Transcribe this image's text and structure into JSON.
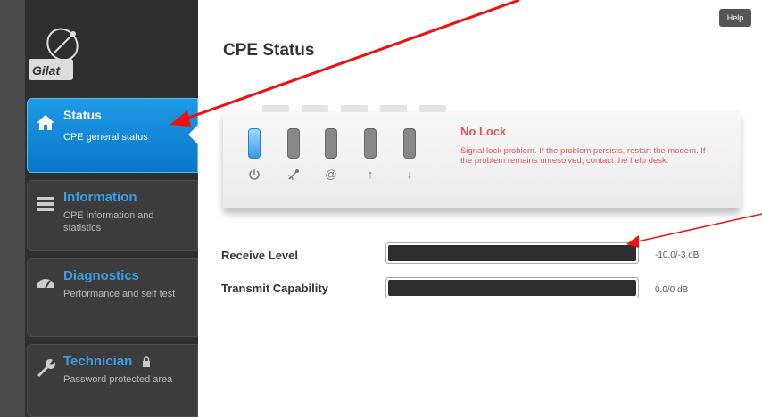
{
  "sidebar": {
    "logo_text": "Gilat",
    "items": [
      {
        "title": "Status",
        "subtitle": "CPE general status",
        "icon": "home-icon",
        "active": true
      },
      {
        "title": "Information",
        "subtitle": "CPE information and statistics",
        "icon": "list-icon",
        "active": false
      },
      {
        "title": "Diagnostics",
        "subtitle": "Performance and self test",
        "icon": "gauge-icon",
        "active": false
      },
      {
        "title": "Technician",
        "subtitle": "Password protected area",
        "icon": "wrench-icon",
        "active": false,
        "lock_icon": "lock-icon"
      }
    ]
  },
  "header": {
    "title": "CPE Status",
    "help_label": "Help"
  },
  "status_panel": {
    "leds": [
      {
        "name": "power",
        "icon": "power-icon",
        "state": "on",
        "color": "#3a9be0"
      },
      {
        "name": "satellite",
        "icon": "satellite-icon",
        "state": "off"
      },
      {
        "name": "internet",
        "icon": "at-icon",
        "state": "off"
      },
      {
        "name": "transmit",
        "icon": "arrow-up-icon",
        "state": "off"
      },
      {
        "name": "receive",
        "icon": "arrow-down-icon",
        "state": "off"
      }
    ],
    "lock_title": "No Lock",
    "lock_message": "Signal lock problem. If the problem persists, restart the modem. If the problem remains unresolved, contact the help desk.",
    "alert_color": "#e0555a"
  },
  "levels": [
    {
      "label": "Receive Level",
      "value": "-10.0/-3 dB",
      "fill": 1.0
    },
    {
      "label": "Transmit Capability",
      "value": "0.0/0 dB",
      "fill": 1.0
    }
  ],
  "annotation_color": "#ee1111"
}
